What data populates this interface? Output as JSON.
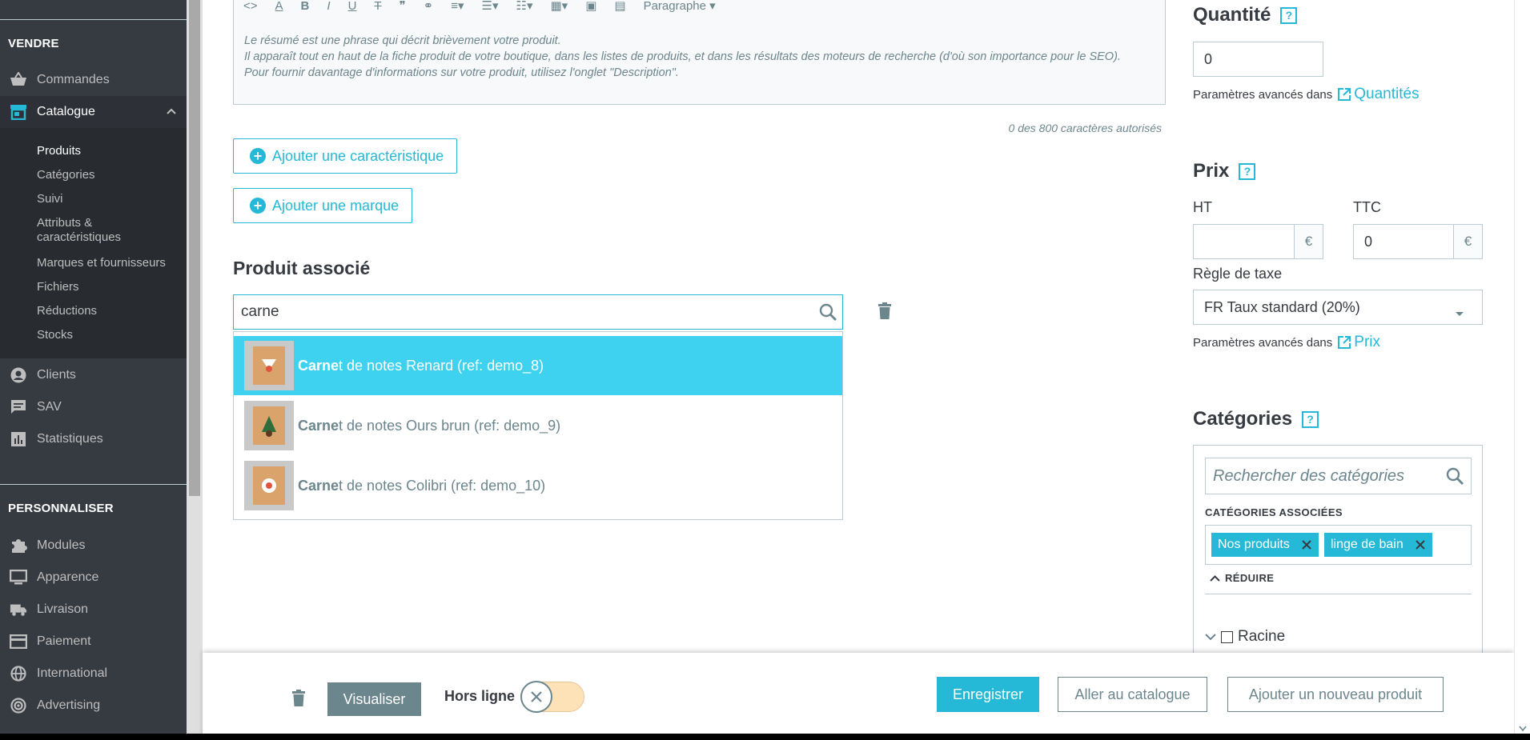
{
  "sidebar": {
    "sell_title": "VENDRE",
    "customize_title": "PERSONNALISER",
    "items": {
      "orders": "Commandes",
      "catalog": "Catalogue",
      "customers": "Clients",
      "sav": "SAV",
      "stats": "Statistiques",
      "modules": "Modules",
      "appearance": "Apparence",
      "shipping": "Livraison",
      "payment": "Paiement",
      "international": "International",
      "advertising": "Advertising"
    },
    "catalog_sub": {
      "products": "Produits",
      "categories": "Catégories",
      "monitoring": "Suivi",
      "attributes_1": "Attributs &",
      "attributes_2": "caractéristiques",
      "brands": "Marques et fournisseurs",
      "files": "Fichiers",
      "discounts": "Réductions",
      "stocks": "Stocks"
    }
  },
  "editor": {
    "toolbar_format": "Paragraphe",
    "line1": "Le résumé est une phrase qui décrit brièvement votre produit.",
    "line2": "Il apparaît tout en haut de la fiche produit de votre boutique, dans les listes de produits, et dans les résultats des moteurs de recherche (d'où son importance pour le SEO).",
    "line3": "Pour fournir davantage d'informations sur votre produit, utilisez l'onglet \"Description\".",
    "char_count": "0 des 800 caractères autorisés"
  },
  "buttons": {
    "add_feature": "Ajouter une caractéristique",
    "add_brand": "Ajouter une marque"
  },
  "associated": {
    "title": "Produit associé",
    "query": "carne",
    "results": [
      {
        "match": "Carne",
        "rest": "t de notes Renard (ref: demo_8)"
      },
      {
        "match": "Carne",
        "rest": "t de notes Ours brun (ref: demo_9)"
      },
      {
        "match": "Carne",
        "rest": "t de notes Colibri (ref: demo_10)"
      }
    ]
  },
  "quantity": {
    "title": "Quantité",
    "help": "?",
    "value": "0",
    "adv_text": "Paramètres avancés dans",
    "adv_link": "Quantités"
  },
  "price": {
    "title": "Prix",
    "help": "?",
    "ht_label": "HT",
    "ttc_label": "TTC",
    "ht_value": "",
    "ttc_value": "0",
    "currency": "€",
    "tax_label": "Règle de taxe",
    "tax_value": "FR Taux standard (20%)",
    "adv_text": "Paramètres avancés dans",
    "adv_link": "Prix"
  },
  "categories": {
    "title": "Catégories",
    "help": "?",
    "search_placeholder": "Rechercher des catégories",
    "assoc_label": "CATÉGORIES ASSOCIÉES",
    "tags": [
      "Nos produits",
      "linge de bain"
    ],
    "reduce": "RÉDUIRE",
    "root": "Racine"
  },
  "bottom_bar": {
    "preview": "Visualiser",
    "offline": "Hors ligne",
    "save": "Enregistrer",
    "go_catalog": "Aller au catalogue",
    "add_product": "Ajouter un nouveau produit"
  },
  "colors": {
    "accent": "#25b9d7",
    "highlight": "#3ed2f0",
    "sidebar": "#363a41"
  }
}
